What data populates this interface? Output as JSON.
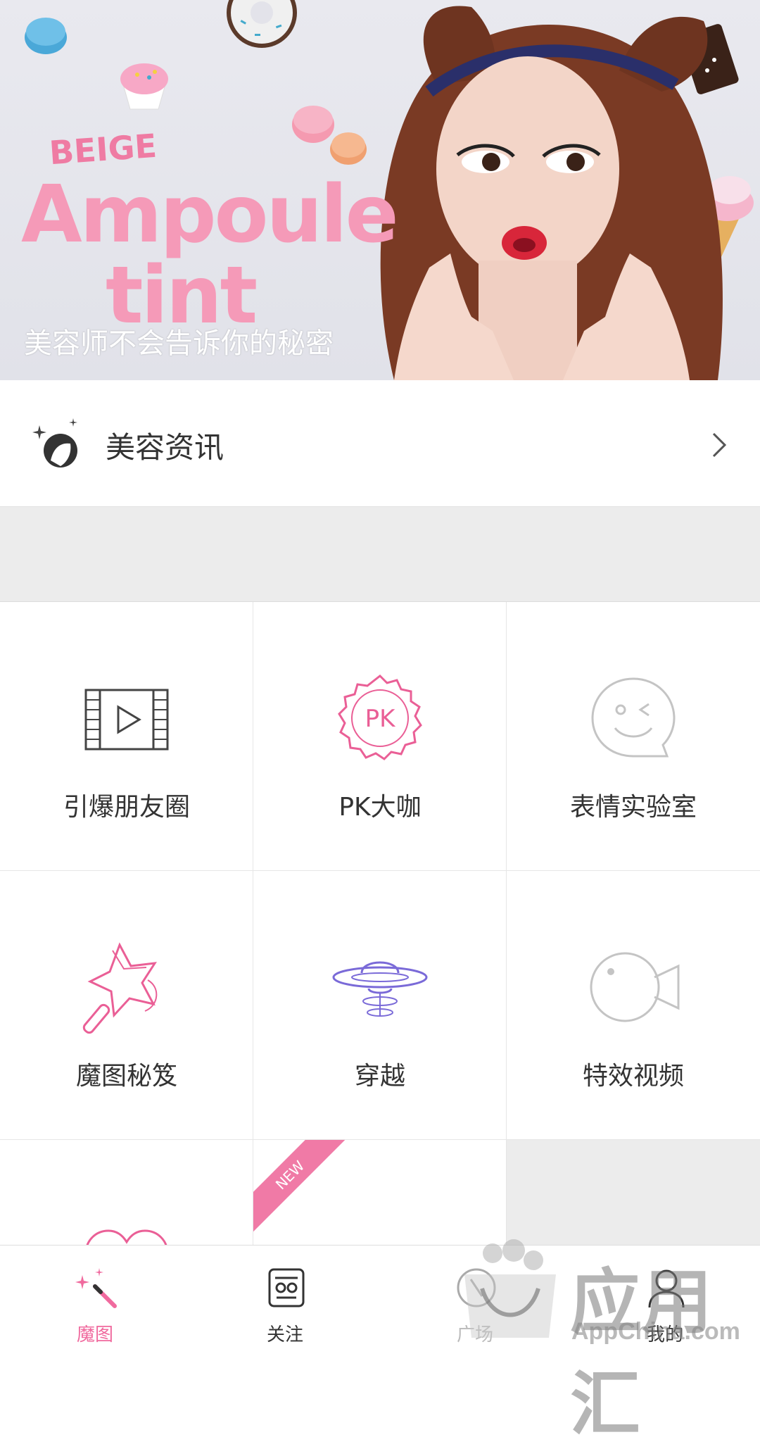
{
  "banner": {
    "brand_small": "BEIGE",
    "headline_1": "Ampoule",
    "headline_2": "tint",
    "caption": "美容师不会告诉你的秘密"
  },
  "news": {
    "icon": "beauty-sparkle-icon",
    "label": "美容资讯",
    "chevron": "chevron-right-icon"
  },
  "grid": {
    "items": [
      {
        "label": "引爆朋友圈",
        "icon": "film-play-icon"
      },
      {
        "label": "PK大咖",
        "icon": "pk-badge-icon",
        "badge_text": "PK"
      },
      {
        "label": "表情实验室",
        "icon": "wink-face-icon"
      },
      {
        "label": "魔图秘笈",
        "icon": "magic-wand-star-icon"
      },
      {
        "label": "穿越",
        "icon": "ufo-icon"
      },
      {
        "label": "特效视频",
        "icon": "video-camera-icon"
      },
      {
        "label": "",
        "icon": "heart-icon"
      },
      {
        "label": "",
        "icon": "crown-icon",
        "ribbon": "NEW"
      }
    ]
  },
  "bottom_nav": {
    "items": [
      {
        "label": "魔图",
        "icon": "magic-wand-icon",
        "active": true
      },
      {
        "label": "关注",
        "icon": "follow-face-icon"
      },
      {
        "label": "广场",
        "icon": "compass-icon"
      },
      {
        "label": "我的",
        "icon": "user-icon"
      }
    ]
  },
  "watermark": {
    "text_cn": "应用汇",
    "text_en": "AppChina.com"
  },
  "colors": {
    "accent_pink": "#f06a9e",
    "icon_purple": "#7a6ad8",
    "icon_gray": "#bdbdbd",
    "text_dark": "#333333",
    "gap_gray": "#ececec"
  }
}
